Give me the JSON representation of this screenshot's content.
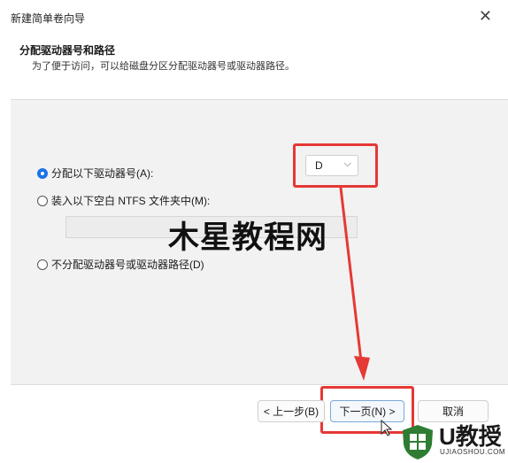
{
  "window": {
    "title": "新建简单卷向导",
    "close_glyph": "✕"
  },
  "header": {
    "title": "分配驱动器号和路径",
    "subtitle": "为了便于访问，可以给磁盘分区分配驱动器号或驱动器路径。"
  },
  "options": [
    {
      "label": "分配以下驱动器号(A):",
      "checked": true
    },
    {
      "label": "装入以下空白 NTFS 文件夹中(M):",
      "checked": false
    },
    {
      "label": "不分配驱动器号或驱动器路径(D)",
      "checked": false
    }
  ],
  "drive_select": {
    "value": "D",
    "chevron": "⌵"
  },
  "buttons": {
    "back": "< 上一步(B)",
    "next": "下一页(N) >",
    "cancel": "取消"
  },
  "watermark": "木星教程网",
  "logo": {
    "text": "U教授",
    "sub": "UJIAOSHOU.COM"
  },
  "colors": {
    "highlight": "#e53935",
    "radio_selected": "#1a73e8"
  }
}
